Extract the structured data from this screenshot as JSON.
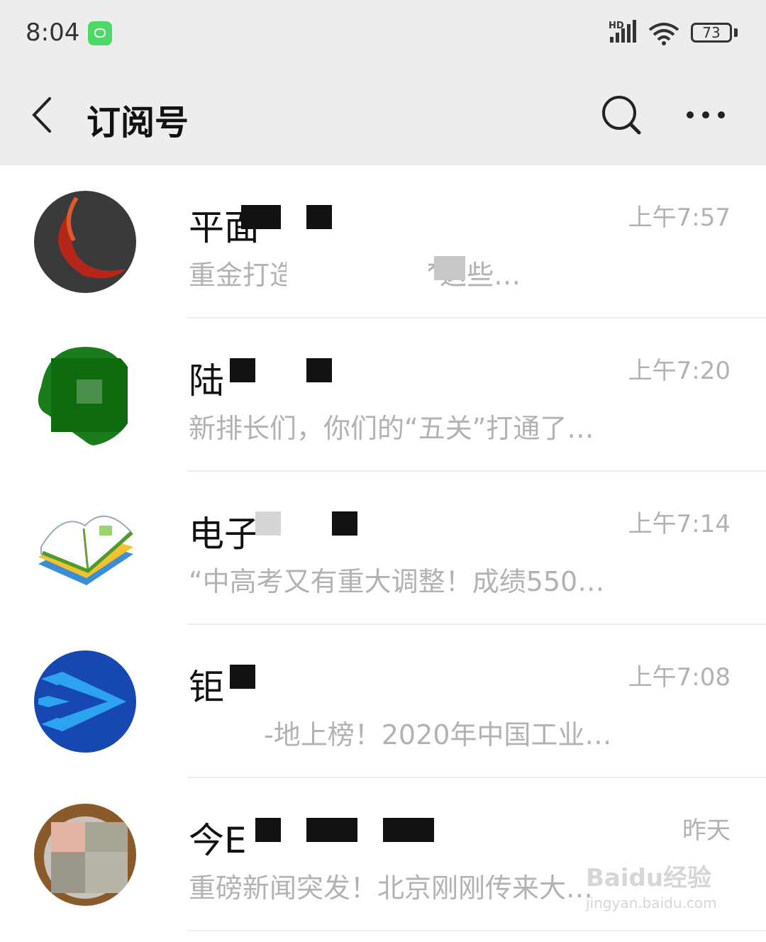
{
  "status_bar": {
    "time": "8:04",
    "battery": "73",
    "signal_label": "HD"
  },
  "nav": {
    "title": "订阅号"
  },
  "items": [
    {
      "name": "平面",
      "time": "上午7:57",
      "preview": "重金打造的…                  是用了这些…"
    },
    {
      "name": "陆",
      "time": "上午7:20",
      "preview": "新排长们，你们的“五关”打通了…"
    },
    {
      "name": "电子",
      "time": "上午7:14",
      "preview": "“中高考又有重大调整！成绩550…"
    },
    {
      "name": "钜",
      "time": "上午7:08",
      "preview": "-地上榜！2020年中国工业…"
    },
    {
      "name": "今E",
      "time": "昨天",
      "preview": "重磅新闻突发！北京刚刚传来大…"
    }
  ],
  "watermark": {
    "brand": "Baidu经验",
    "url": "jingyan.baidu.com"
  },
  "colors": {
    "topbar_bg": "#ededed",
    "secondary_text": "#b2b2b2",
    "divider": "#ececec",
    "status_icon_green": "#4cd964"
  }
}
